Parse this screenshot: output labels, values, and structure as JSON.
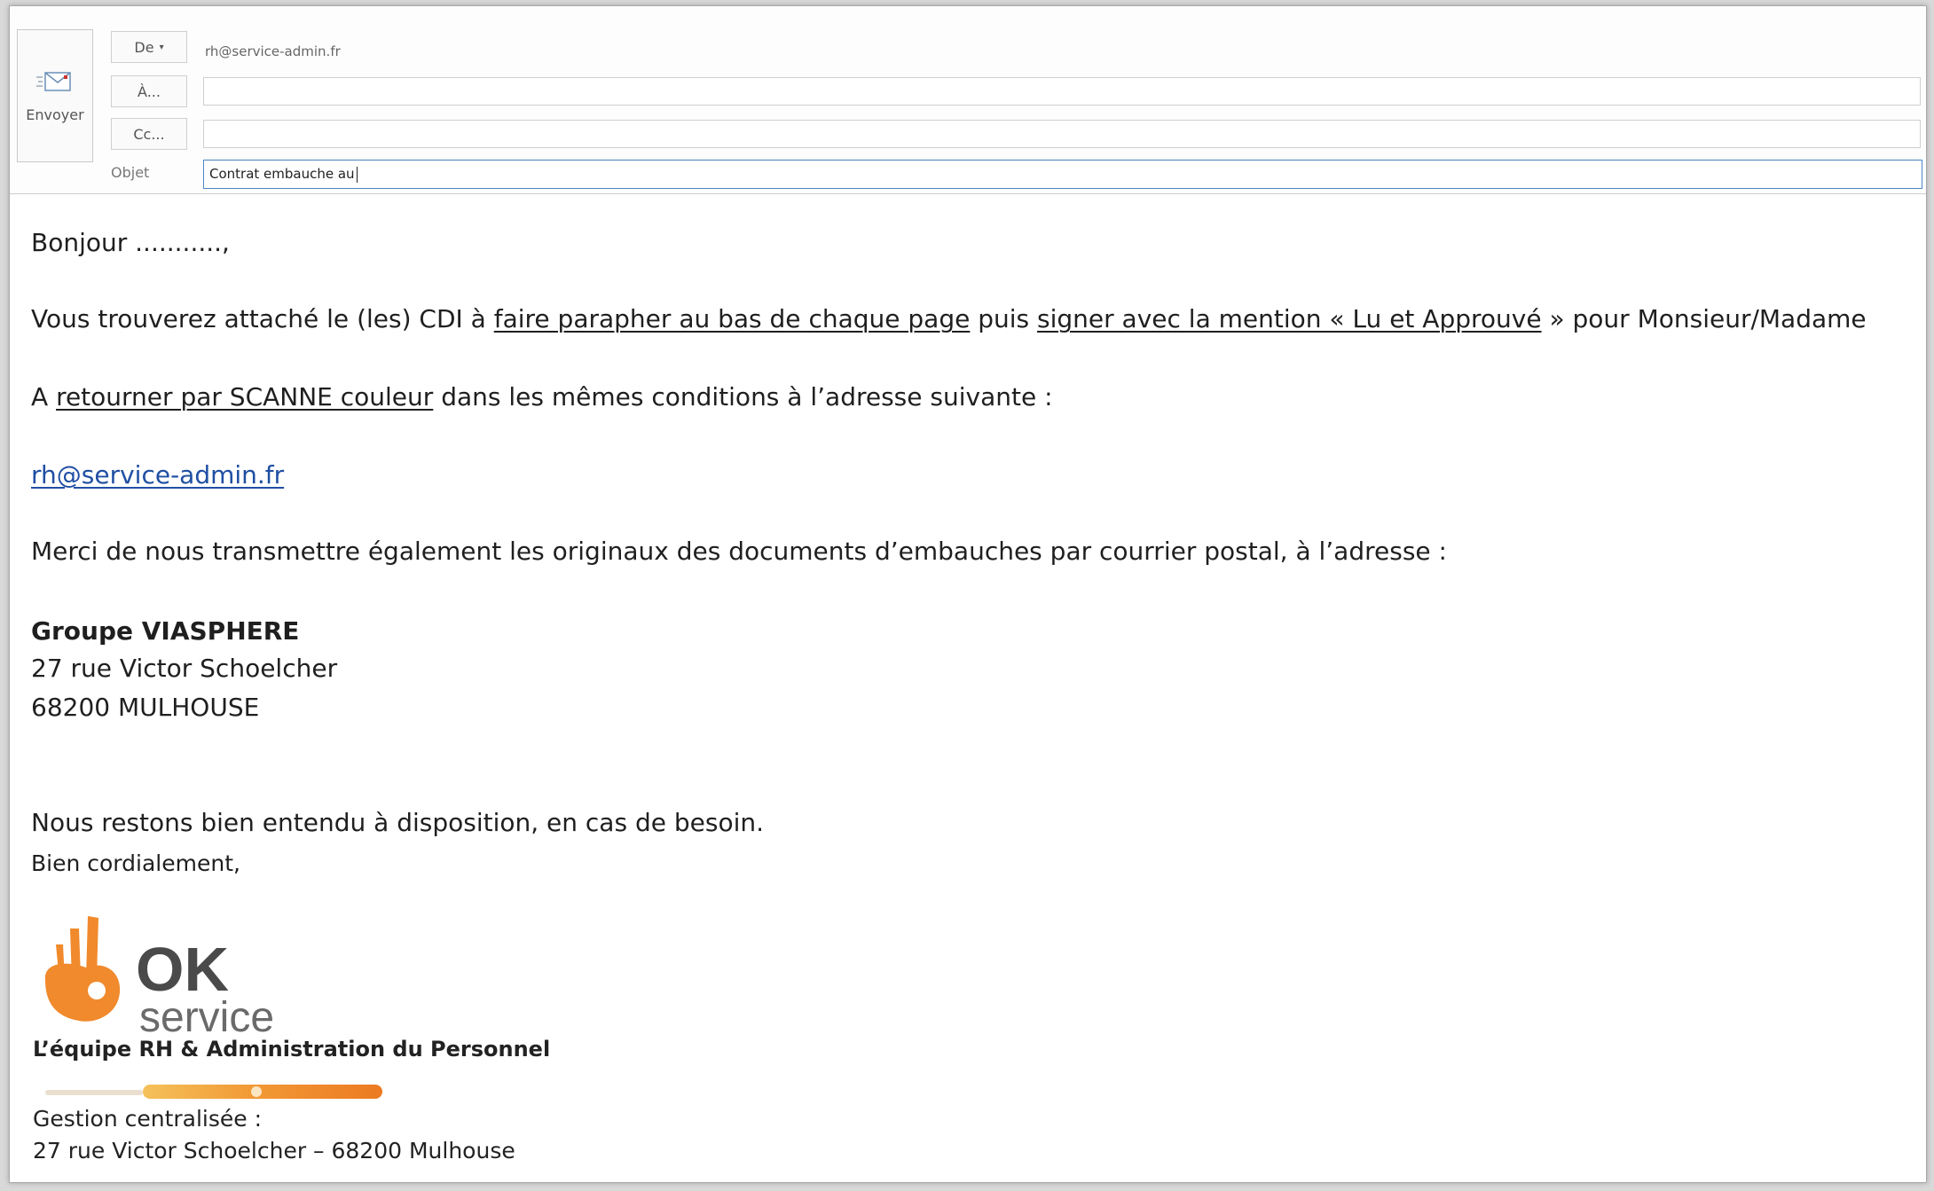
{
  "header": {
    "send_label": "Envoyer",
    "from_label": "De",
    "from_value": "rh@service-admin.fr",
    "to_label": "À...",
    "to_value": "",
    "cc_label": "Cc...",
    "cc_value": "",
    "subject_label": "Objet",
    "subject_value": "Contrat embauche au"
  },
  "body": {
    "greeting": "Bonjour ...........,",
    "p1": {
      "a": "Vous trouverez attaché le (les)  CDI à ",
      "u1": "faire parapher au bas de chaque page",
      "b": " puis ",
      "u2": "signer avec la mention « Lu et Approuvé",
      "c": " » pour Monsieur/Madame"
    },
    "p2": {
      "a": "A ",
      "u": "retourner par SCANNE couleur",
      "b": " dans les mêmes conditions à l’adresse suivante :"
    },
    "email_link": "rh@service-admin.fr",
    "p3": "Merci de nous transmettre également les originaux des documents d’embauches par courrier postal, à l’adresse :",
    "address": {
      "company": "Groupe VIASPHERE",
      "street": "27 rue Victor Schoelcher",
      "city": "68200 MULHOUSE"
    },
    "closing1": "Nous restons  bien entendu à disposition, en cas de besoin.",
    "closing2": "Bien cordialement,"
  },
  "signature": {
    "logo_text_ok": "OK",
    "logo_text_service": "service",
    "tagline": "L’équipe RH & Administration du Personnel",
    "mgmt_label": "Gestion centralisée :",
    "mgmt_address": "27 rue Victor Schoelcher – 68200 Mulhouse"
  },
  "colors": {
    "accent_orange": "#f08a2c",
    "logo_gray": "#4a4a4a",
    "link_blue": "#1f4fa3",
    "subject_border": "#4a86c5"
  }
}
